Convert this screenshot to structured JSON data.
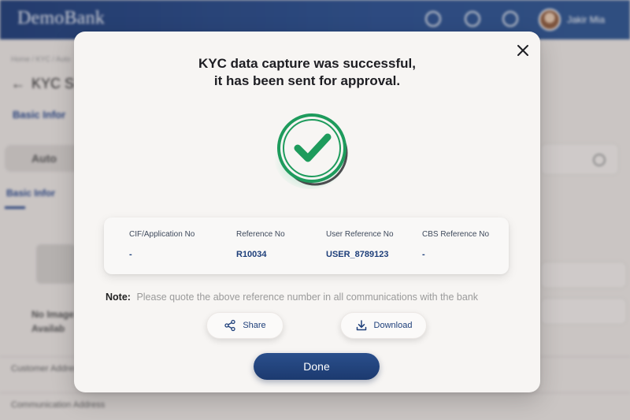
{
  "background": {
    "brand": "DemoBank",
    "user_name": "Jakir Mia",
    "breadcrumb": "Home / KYC / Auto",
    "page_heading": "KYC S",
    "basic_info_link": "Basic Infor",
    "auto_tab": "Auto",
    "basic_info_subtab": "Basic Infor",
    "no_image_text": "No Image Availab",
    "row_texts": [
      "Customer Address",
      "Communication Address"
    ]
  },
  "modal": {
    "title_line1": "KYC data capture was successful,",
    "title_line2": "it has been sent for approval.",
    "references": [
      {
        "label": "CIF/Application No",
        "value": "-"
      },
      {
        "label": "Reference No",
        "value": "R10034"
      },
      {
        "label": "User Reference No",
        "value": "USER_8789123"
      },
      {
        "label": "CBS Reference No",
        "value": "-"
      }
    ],
    "note_label": "Note:",
    "note_text": "Please quote the above reference number in all communications with the bank",
    "share_label": "Share",
    "download_label": "Download",
    "done_label": "Done"
  },
  "icons": {
    "close": "close-icon",
    "success": "check-circle-icon",
    "share": "share-icon",
    "download": "download-icon",
    "search": "search-icon",
    "notifications": "bell-icon",
    "settings": "gear-icon"
  },
  "colors": {
    "primary": "#1e3f7a",
    "success": "#1e9b5c",
    "modal_bg": "#f7f5f3"
  }
}
